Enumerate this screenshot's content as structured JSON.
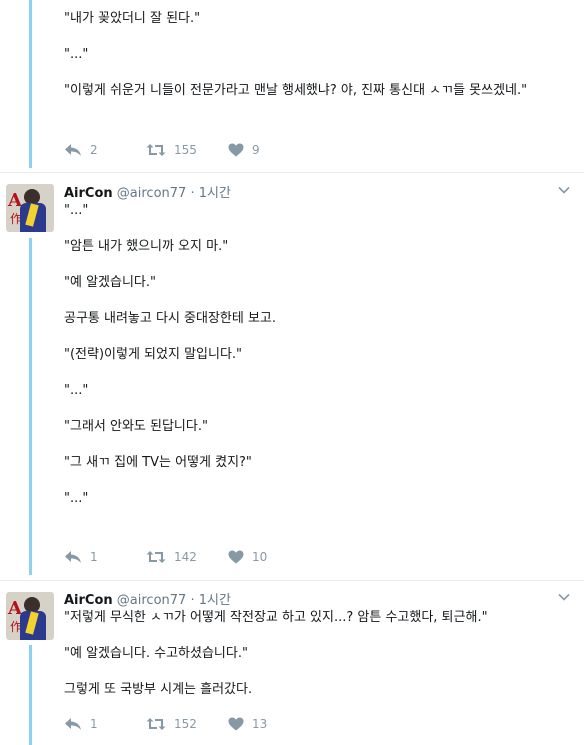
{
  "tweets": [
    {
      "text": "\"내가 꽂았더니 잘 된다.\"\n\n\"...\"\n\n\"이렇게 쉬운거 니들이 전문가라고 맨날 행세했냐? 야, 진짜 통신대 ㅅㄲ들 못쓰겠네.\"",
      "replies": "2",
      "retweets": "155",
      "likes": "9"
    },
    {
      "display_name": "AirCon",
      "username": "@aircon77",
      "separator": "·",
      "time": "1시간",
      "text": "\"...\"\n\n\"암튼 내가 했으니까 오지 마.\"\n\n\"예 알겠습니다.\"\n\n공구통 내려놓고 다시 중대장한테 보고.\n\n\"(전략)이렇게 되었지 말입니다.\"\n\n\"...\"\n\n\"그래서 안와도 된답니다.\"\n\n\"그 새ㄲ 집에 TV는 어떻게 켰지?\"\n\n\"...\"",
      "replies": "1",
      "retweets": "142",
      "likes": "10"
    },
    {
      "display_name": "AirCon",
      "username": "@aircon77",
      "separator": "·",
      "time": "1시간",
      "text": "\"저렇게 무식한 ㅅㄲ가 어떻게 작전장교 하고 있지...? 암튼 수고했다, 퇴근해.\"\n\n\"예 알겠습니다. 수고하셨습니다.\"\n\n그렇게 또 국방부 시계는 흘러갔다.",
      "replies": "1",
      "retweets": "152",
      "likes": "13"
    }
  ],
  "icons": {
    "reply": "reply-icon",
    "retweet": "retweet-icon",
    "like": "heart-icon",
    "more": "chevron-down-icon"
  },
  "colors": {
    "thread_line": "#8ed0f2",
    "action_gray": "#8899a6",
    "username_gray": "#657786"
  }
}
